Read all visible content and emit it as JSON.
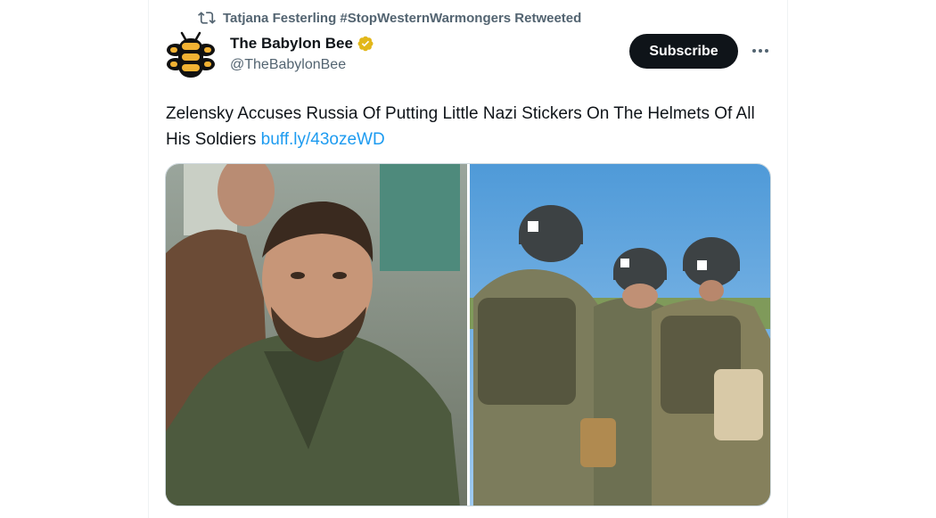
{
  "retweet": {
    "icon": "retweet-icon",
    "text": "Tatjana Festerling #StopWesternWarmongers Retweeted"
  },
  "author": {
    "name": "The Babylon Bee",
    "handle": "@TheBabylonBee",
    "verified_badge_color": "#e2b719"
  },
  "actions": {
    "subscribe_label": "Subscribe",
    "more_icon": "more-icon"
  },
  "tweet": {
    "text": "Zelensky Accuses Russia Of Putting Little Nazi Stickers On The Helmets Of All His Soldiers",
    "link": "buff.ly/43ozeWD"
  },
  "colors": {
    "text": "#0f1419",
    "secondary": "#536471",
    "link": "#1d9bf0",
    "button": "#0f1419",
    "bee_yellow": "#f2b233"
  }
}
